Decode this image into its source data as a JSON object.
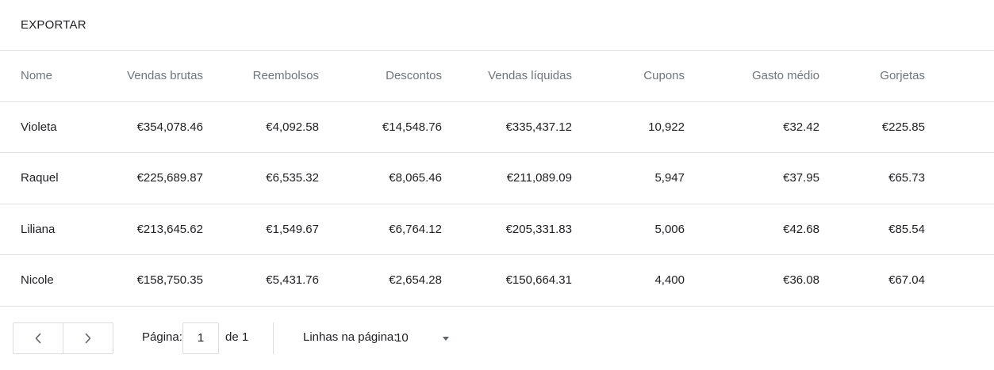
{
  "toolbar": {
    "export_label": "EXPORTAR"
  },
  "table": {
    "columns": {
      "name": "Nome",
      "gross_sales": "Vendas brutas",
      "refunds": "Reembolsos",
      "discounts": "Descontos",
      "net_sales": "Vendas líquidas",
      "coupons": "Cupons",
      "avg_spend": "Gasto médio",
      "tips": "Gorjetas"
    },
    "rows": [
      {
        "name": "Violeta",
        "gross_sales": "€354,078.46",
        "refunds": "€4,092.58",
        "discounts": "€14,548.76",
        "net_sales": "€335,437.12",
        "coupons": "10,922",
        "avg_spend": "€32.42",
        "tips": "€225.85"
      },
      {
        "name": "Raquel",
        "gross_sales": "€225,689.87",
        "refunds": "€6,535.32",
        "discounts": "€8,065.46",
        "net_sales": "€211,089.09",
        "coupons": "5,947",
        "avg_spend": "€37.95",
        "tips": "€65.73"
      },
      {
        "name": "Liliana",
        "gross_sales": "€213,645.62",
        "refunds": "€1,549.67",
        "discounts": "€6,764.12",
        "net_sales": "€205,331.83",
        "coupons": "5,006",
        "avg_spend": "€42.68",
        "tips": "€85.54"
      },
      {
        "name": "Nicole",
        "gross_sales": "€158,750.35",
        "refunds": "€5,431.76",
        "discounts": "€2,654.28",
        "net_sales": "€150,664.31",
        "coupons": "4,400",
        "avg_spend": "€36.08",
        "tips": "€67.04"
      }
    ]
  },
  "pagination": {
    "prev_icon": "chevron-left-icon",
    "next_icon": "chevron-right-icon",
    "page_label": "Página:",
    "current_page": "1",
    "total_label": "de 1",
    "rows_label": "Linhas na página:",
    "rows_value": "10",
    "rows_icon": "caret-down-icon"
  },
  "colors": {
    "text": "#202124",
    "header_text": "#70757a",
    "border": "#e0e0e0"
  }
}
